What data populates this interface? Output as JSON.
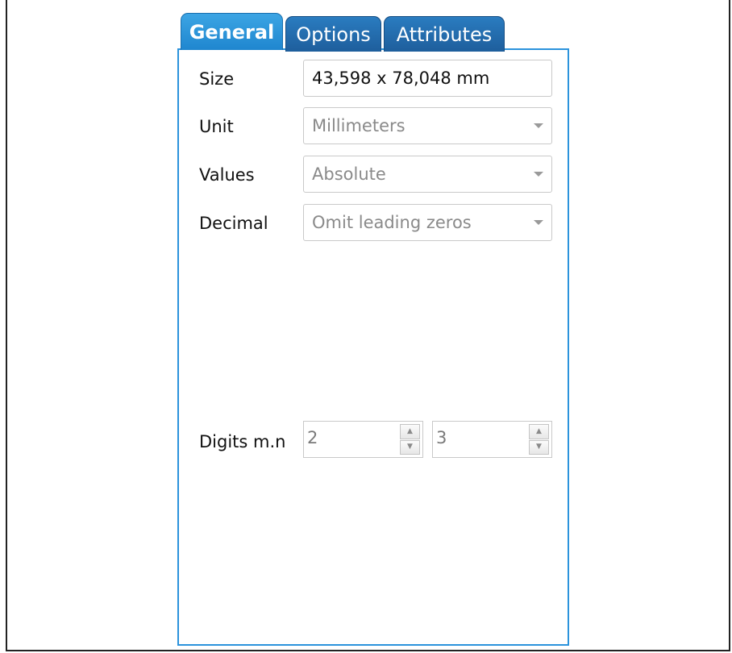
{
  "tabs": {
    "general": "General",
    "options": "Options",
    "attributes": "Attributes"
  },
  "fields": {
    "size": {
      "label": "Size",
      "value": "43,598 x 78,048 mm"
    },
    "unit": {
      "label": "Unit",
      "value": "Millimeters"
    },
    "values": {
      "label": "Values",
      "value": "Absolute"
    },
    "decimal": {
      "label": "Decimal",
      "value": "Omit leading zeros"
    },
    "digits": {
      "label": "Digits m.n",
      "m": "2",
      "n": "3"
    }
  },
  "icons": {
    "dropdown": "chevron-down-icon",
    "spin_up": "chevron-up-icon",
    "spin_down": "chevron-down-icon"
  },
  "colors": {
    "active_tab": "#2b93dc",
    "inactive_tab": "#1e5e9c",
    "panel_border": "#2b93dc"
  }
}
